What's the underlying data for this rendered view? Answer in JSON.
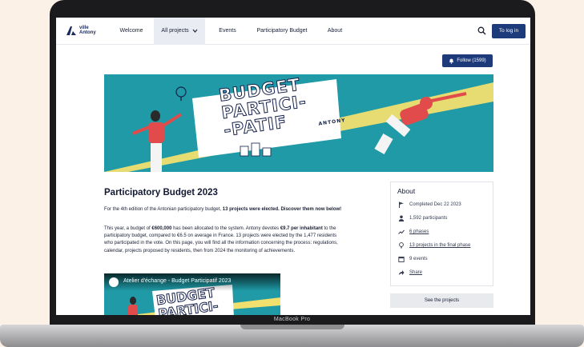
{
  "device": {
    "label": "MacBook Pro"
  },
  "nav": {
    "logo_line1": "ville",
    "logo_line2": "Antony",
    "items": [
      {
        "label": "Welcome"
      },
      {
        "label": "All projects"
      },
      {
        "label": "Events"
      },
      {
        "label": "Participatory Budget"
      },
      {
        "label": "About"
      }
    ],
    "login_label": "To log in"
  },
  "follow": {
    "label": "Follow (1599)"
  },
  "banner": {
    "line1": "BUDGET",
    "line2": "PARTICI-",
    "line3": "-PATIF",
    "line4": "ANTONY"
  },
  "main": {
    "title": "Participatory Budget 2023",
    "intro_prefix": "For the 4th edition of the Antonian participatory budget, ",
    "intro_bold": "13 projects were elected. Discover them now below!",
    "p1_a": "This year, a budget of ",
    "p1_b": "€600,000",
    "p1_c": " has been allocated to the system. Antony devotes ",
    "p1_d": "€9.7 per inhabitant",
    "p1_e": " to the participatory budget, compared to €6.5 on average in France. 13 projects were elected by the 1,477 residents who participated in the vote. On this page, you will find all the information concerning the process: regulations, calendar, projects proposed by residents, then from 2024 the monitoring of achievements.",
    "video_title": "Atelier d'échange - Budget Participatif 2023",
    "video_banner_1": "BUDGET",
    "video_banner_2": "PARTICI-"
  },
  "about": {
    "title": "About",
    "rows": [
      {
        "icon": "flag-icon",
        "text": "Completed Dec 22 2023"
      },
      {
        "icon": "person-icon",
        "text": "1,592 participants"
      },
      {
        "icon": "trend-icon",
        "text": "6 phases"
      },
      {
        "icon": "bulb-icon",
        "text": "13 projects in the final phase"
      },
      {
        "icon": "calendar-icon",
        "text": "9 events"
      },
      {
        "icon": "share-icon",
        "text": "Share"
      }
    ],
    "see_projects": "See the projects"
  },
  "colors": {
    "brand": "#1d3a7a",
    "banner": "#1f9aa6",
    "accent": "#f1df6e",
    "figure_red": "#e24b4b"
  }
}
